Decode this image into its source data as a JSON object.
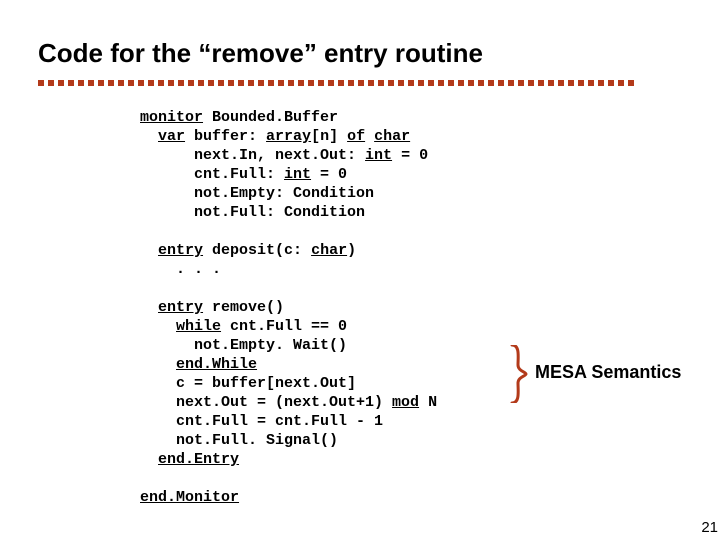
{
  "title": "Code for the “remove” entry routine",
  "code": {
    "l01a": "monitor",
    "l01b": " Bounded.Buffer",
    "l02a": "  ",
    "l02b": "var",
    "l02c": " buffer: ",
    "l02d": "array",
    "l02e": "[n] ",
    "l02f": "of",
    "l02g": " ",
    "l02h": "char",
    "l03a": "      next.In, next.Out: ",
    "l03b": "int",
    "l03c": " = 0",
    "l04a": "      cnt.Full: ",
    "l04b": "int",
    "l04c": " = 0",
    "l05": "      not.Empty: Condition",
    "l06": "      not.Full: Condition",
    "blank1": "",
    "l07a": "  ",
    "l07b": "entry",
    "l07c": " deposit(c: ",
    "l07d": "char",
    "l07e": ")",
    "l08": "    . . .",
    "blank2": "",
    "l09a": "  ",
    "l09b": "entry",
    "l09c": " remove()",
    "l10a": "    ",
    "l10b": "while",
    "l10c": " cnt.Full == 0",
    "l11": "      not.Empty. Wait()",
    "l12a": "    ",
    "l12b": "end.While",
    "l13": "    c = buffer[next.Out]",
    "l14a": "    next.Out = (next.Out+1) ",
    "l14b": "mod",
    "l14c": " N",
    "l15": "    cnt.Full = cnt.Full - 1",
    "l16": "    not.Full. Signal()",
    "l17a": "  ",
    "l17b": "end.Entry",
    "blank3": "",
    "l18": "end.Monitor"
  },
  "annotation": "MESA Semantics",
  "page_number": "21"
}
